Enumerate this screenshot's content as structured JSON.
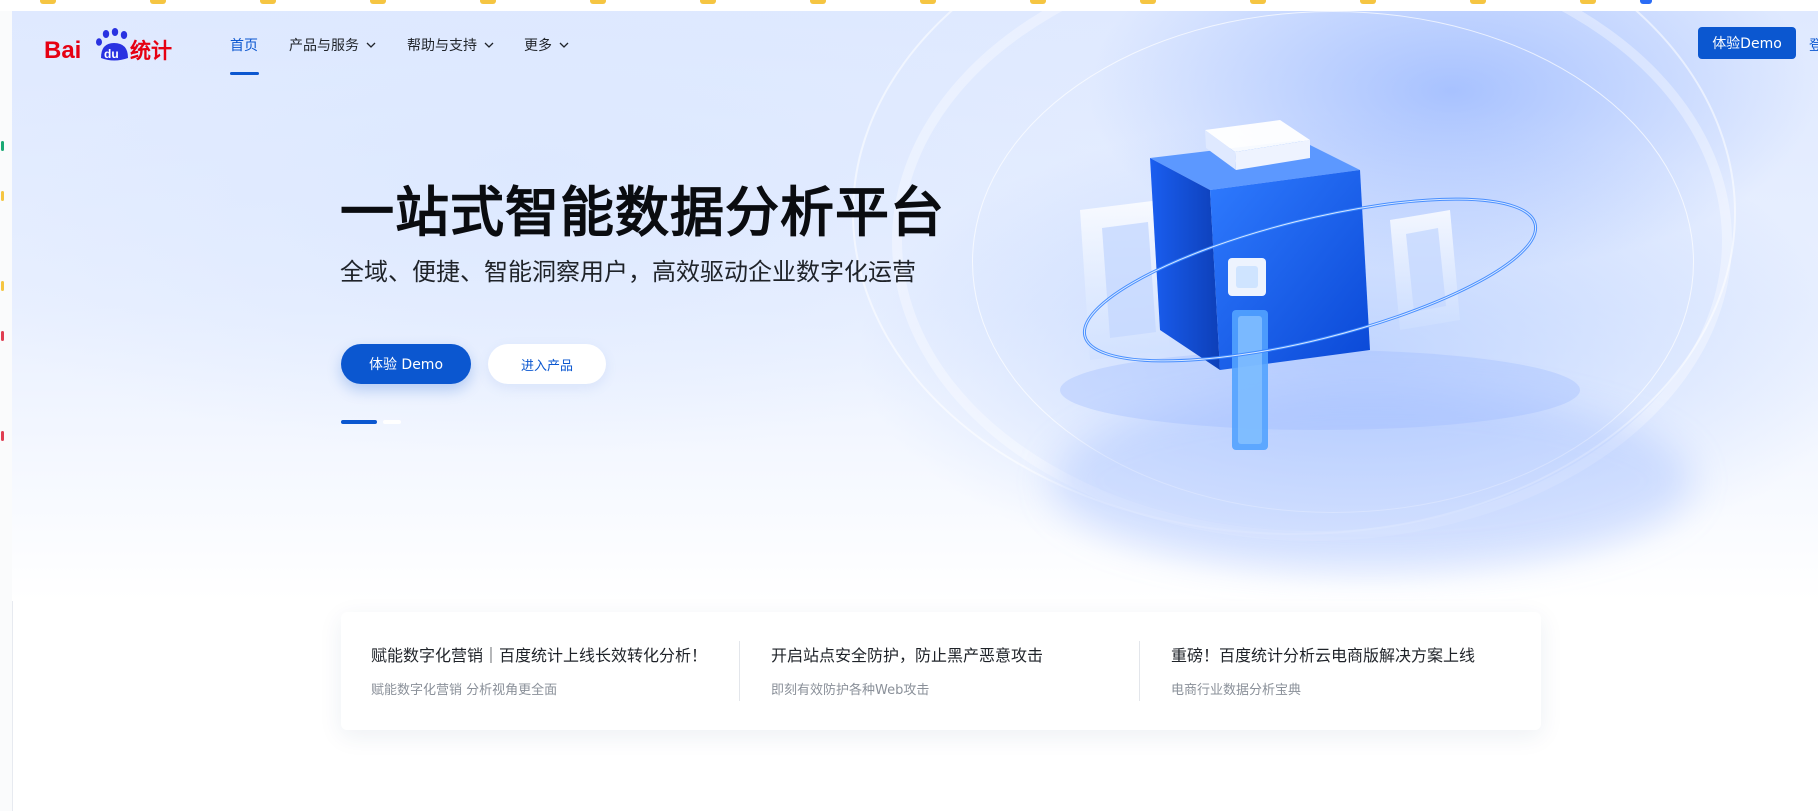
{
  "brand": {
    "logo_text": "Bai du 统计",
    "colors": {
      "red": "#e60012",
      "blue": "#2932e1",
      "accent": "#0b57d0"
    }
  },
  "nav": {
    "items": [
      {
        "label": "首页",
        "active": true
      },
      {
        "label": "产品与服务",
        "dropdown": true
      },
      {
        "label": "帮助与支持",
        "dropdown": true
      },
      {
        "label": "更多",
        "dropdown": true
      }
    ],
    "demo_button": "体验Demo",
    "login_link": "登"
  },
  "hero": {
    "title": "一站式智能数据分析平台",
    "subtitle": "全域、便捷、智能洞察用户，高效驱动企业数字化运营",
    "cta_primary": "体验 Demo",
    "cta_secondary": "进入产品",
    "carousel": {
      "slides": 2,
      "active_index": 0
    },
    "art_letter": "i"
  },
  "news": [
    {
      "title": "赋能数字化营销｜百度统计上线长效转化分析！",
      "subtitle": "赋能数字化营销 分析视角更全面"
    },
    {
      "title": "开启站点安全防护，防止黑产恶意攻击",
      "subtitle": "即刻有效防护各种Web攻击"
    },
    {
      "title": "重磅！百度统计分析云电商版解决方案上线",
      "subtitle": "电商行业数据分析宝典"
    }
  ]
}
